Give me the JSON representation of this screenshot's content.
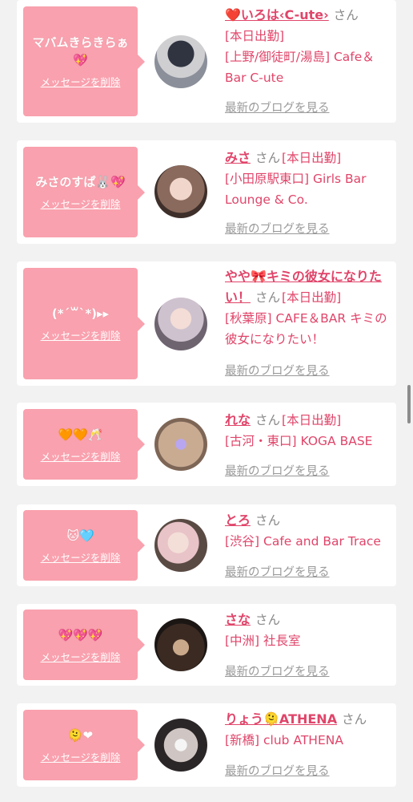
{
  "delete_label": "メッセージを削除",
  "blog_label": "最新のブログを見る",
  "san_label": "さん",
  "entries": [
    {
      "message": "マバムきらきらぁ💖",
      "name": "❤️いろは‹C-ute›",
      "status": "[本日出勤]",
      "shop": "[上野/御徒町/湯島] Cafe＆Bar C-ute"
    },
    {
      "message": "みさのすぱ🐰💖",
      "name": "みさ",
      "status": "[本日出勤]",
      "shop": "[小田原駅東口] Girls Bar Lounge & Co."
    },
    {
      "message": "(*´꒳`*)▸▸",
      "name": "やや🎀キミの彼女になりたい！",
      "status": "[本日出勤]",
      "shop": "[秋葉原] CAFE＆BAR キミの彼女になりたい！"
    },
    {
      "message": "🧡🧡🥂",
      "name": "れな",
      "status": "[本日出勤]",
      "shop": "[古河・東口] KOGA BASE"
    },
    {
      "message": "🐱🩵",
      "name": "とろ",
      "status": "",
      "shop": "[渋谷] Cafe and Bar Trace"
    },
    {
      "message": "💖💖💖",
      "name": "さな",
      "status": "",
      "shop": "[中洲] 社長室"
    },
    {
      "message": "🫠❤",
      "name": "りょう🫠ATHENA",
      "status": "",
      "shop": "[新橋] club ATHENA"
    }
  ],
  "colors": {
    "pink_bubble": "#f9a1ae",
    "name_pink": "#e0456a",
    "background": "#f2f2f2"
  },
  "icons": {
    "avatar": "user-avatar-photo"
  }
}
